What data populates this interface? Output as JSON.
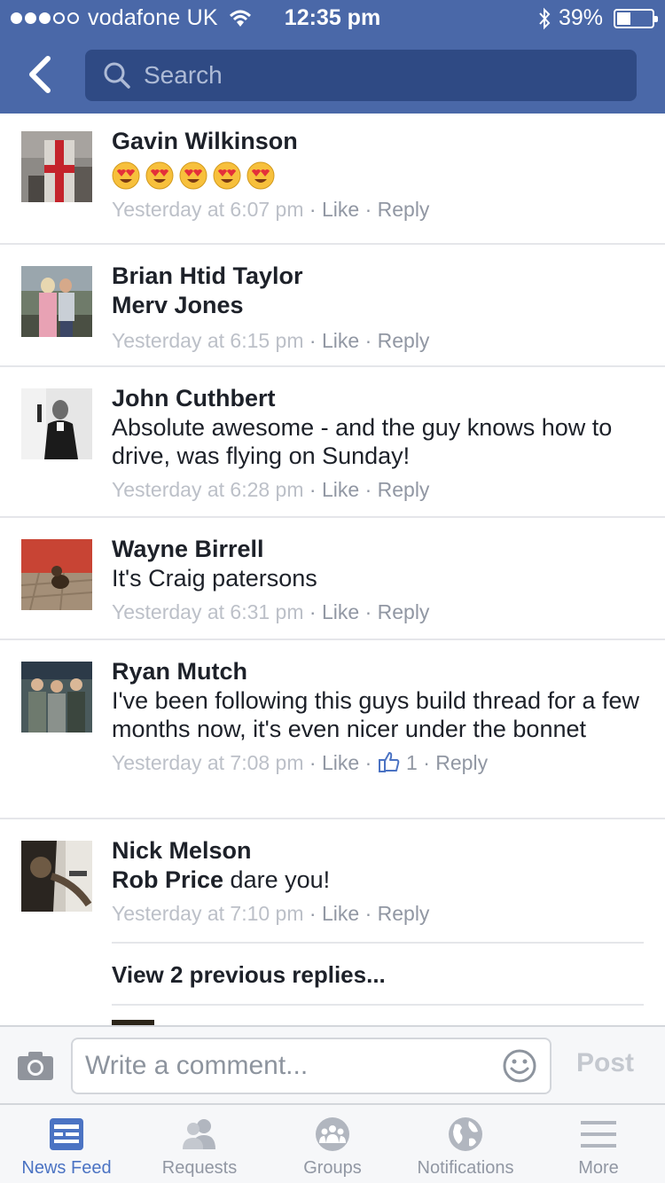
{
  "status_bar": {
    "carrier": "vodafone UK",
    "time": "12:35 pm",
    "battery": "39%",
    "battery_level": 0.39
  },
  "header": {
    "back_icon": "chevron-left-icon",
    "search_placeholder": "Search"
  },
  "comments": [
    {
      "author": "Gavin Wilkinson",
      "text": "",
      "emojis": [
        "heart-eyes-emoji",
        "heart-eyes-emoji",
        "heart-eyes-emoji",
        "heart-eyes-emoji",
        "heart-eyes-emoji"
      ],
      "time": "Yesterday at 6:07 pm",
      "like_label": "Like",
      "reply_label": "Reply"
    },
    {
      "author": "Brian Htid Taylor",
      "text_strong": "Merv Jones",
      "text": "",
      "time": "Yesterday at 6:15 pm",
      "like_label": "Like",
      "reply_label": "Reply"
    },
    {
      "author": "John Cuthbert",
      "text": "Absolute awesome - and the guy knows how to drive, was flying on Sunday!",
      "time": "Yesterday at 6:28 pm",
      "like_label": "Like",
      "reply_label": "Reply"
    },
    {
      "author": "Wayne Birrell",
      "text": "It's Craig patersons",
      "time": "Yesterday at 6:31 pm",
      "like_label": "Like",
      "reply_label": "Reply"
    },
    {
      "author": "Ryan Mutch",
      "text": "I've been following this guys build thread for a few months now, it's even nicer under the bonnet",
      "time": "Yesterday at 7:08 pm",
      "like_label": "Like",
      "like_count": "1",
      "reply_label": "Reply"
    },
    {
      "author": "Nick Melson",
      "text_strong": "Rob Price",
      "text": " dare you!",
      "time": "Yesterday at 7:10 pm",
      "like_label": "Like",
      "reply_label": "Reply"
    }
  ],
  "view_previous": "View 2 previous replies...",
  "composer": {
    "placeholder": "Write a comment...",
    "post_label": "Post"
  },
  "tabs": [
    {
      "label": "News Feed",
      "icon": "news-feed-icon",
      "active": true
    },
    {
      "label": "Requests",
      "icon": "friend-requests-icon",
      "active": false
    },
    {
      "label": "Groups",
      "icon": "groups-icon",
      "active": false
    },
    {
      "label": "Notifications",
      "icon": "globe-icon",
      "active": false
    },
    {
      "label": "More",
      "icon": "menu-icon",
      "active": false
    }
  ],
  "colors": {
    "header_bg": "#4a68a8",
    "search_bg": "#2f4a84",
    "active_tab": "#4b73c3",
    "meta_text": "#9197a3"
  }
}
